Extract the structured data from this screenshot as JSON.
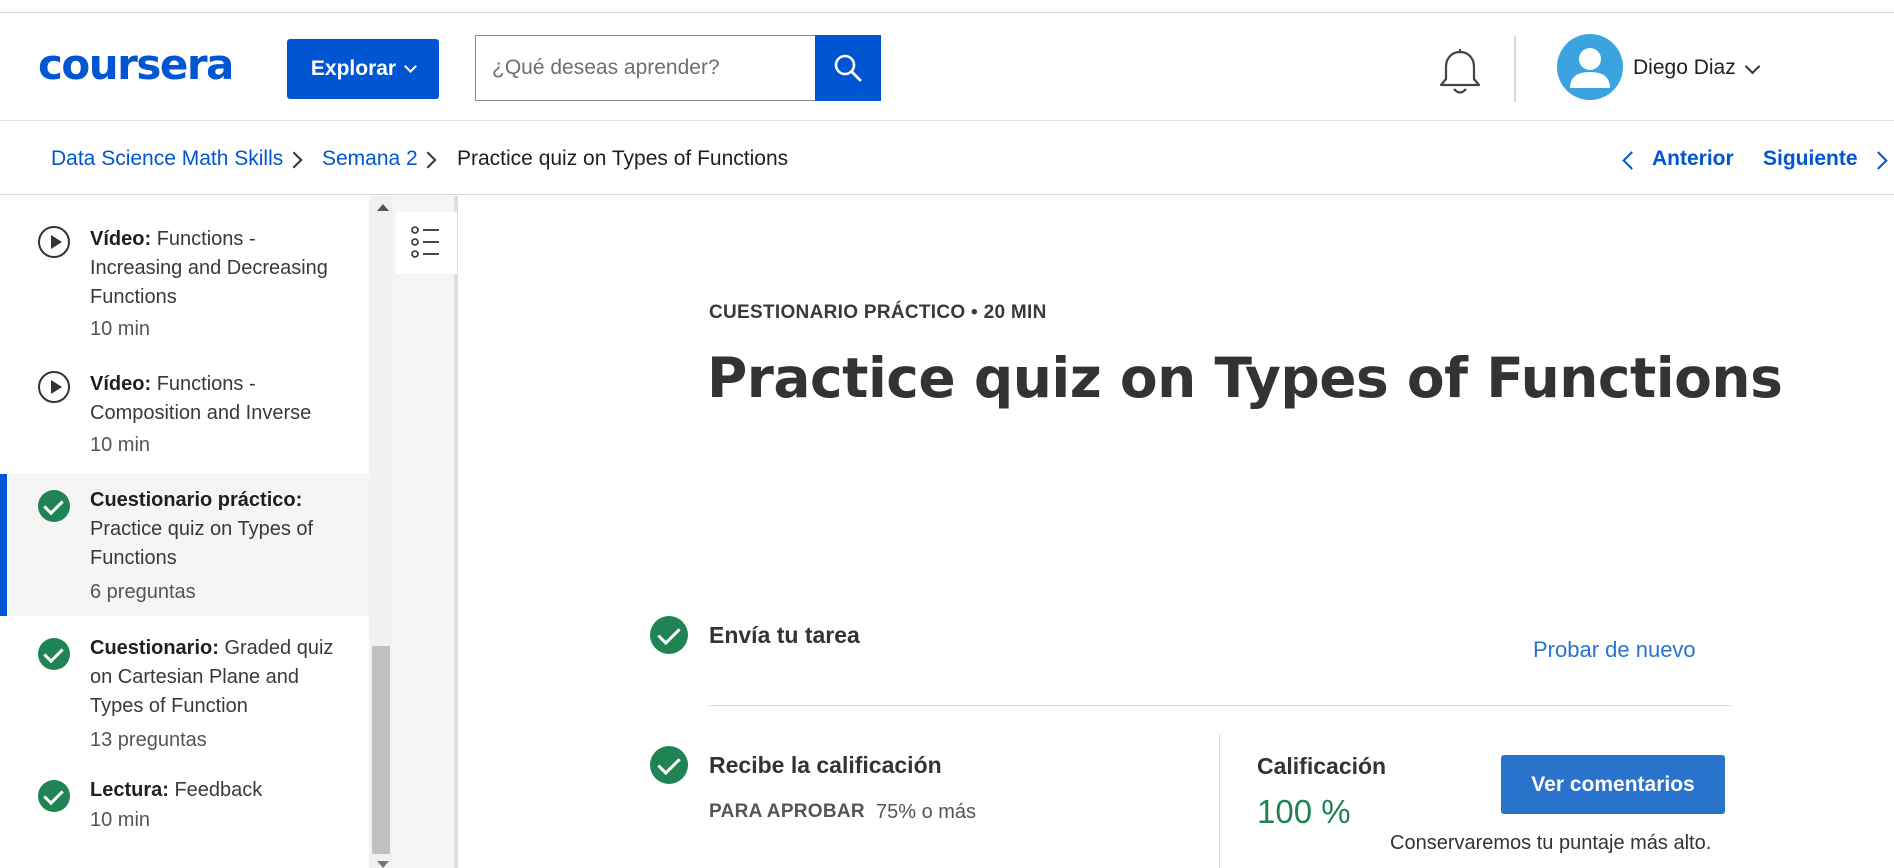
{
  "header": {
    "logo": "coursera",
    "explore_label": "Explorar",
    "search_placeholder": "¿Qué deseas aprender?",
    "user_name": "Diego Diaz"
  },
  "breadcrumb": {
    "items": [
      "Data Science Math Skills",
      "Semana 2",
      "Practice quiz on Types of Functions"
    ],
    "prev_label": "Anterior",
    "next_label": "Siguiente"
  },
  "sidebar": {
    "items": [
      {
        "type_label": "Vídeo:",
        "title": "Functions - Increasing and Decreasing Functions",
        "meta": "10 min",
        "icon": "play-icon",
        "completed": false,
        "active": false
      },
      {
        "type_label": "Vídeo:",
        "title": "Functions - Composition and Inverse",
        "meta": "10 min",
        "icon": "play-icon",
        "completed": false,
        "active": false
      },
      {
        "type_label": "Cuestionario práctico:",
        "title": "Practice quiz on Types of Functions",
        "meta": "6 preguntas",
        "icon": "check-circle-icon",
        "completed": true,
        "active": true
      },
      {
        "type_label": "Cuestionario:",
        "title": "Graded quiz on Cartesian Plane and Types of Function",
        "meta": "13 preguntas",
        "icon": "check-circle-icon",
        "completed": true,
        "active": false
      },
      {
        "type_label": "Lectura:",
        "title": "Feedback",
        "meta": "10 min",
        "icon": "check-circle-icon",
        "completed": true,
        "active": false
      }
    ]
  },
  "main": {
    "kicker": "CUESTIONARIO PRÁCTICO • 20 MIN",
    "title": "Practice quiz on Types of Functions",
    "submit_step": "Envía tu tarea",
    "retry_label": "Probar de nuevo",
    "grade_step": "Recibe la calificación",
    "pass_label": "PARA APROBAR",
    "pass_value": "75% o más",
    "grade_label": "Calificación",
    "grade_value": "100 %",
    "feedback_button": "Ver comentarios",
    "keep_note": "Conservaremos tu puntaje más alto."
  },
  "colors": {
    "brand": "#0056d2",
    "success": "#1f8354",
    "link": "#2a73cc"
  }
}
